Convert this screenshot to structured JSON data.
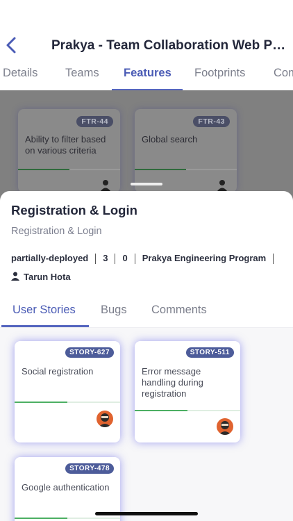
{
  "header": {
    "title": "Prakya - Team Collaboration Web Platf…",
    "tabs": [
      {
        "label": "Details"
      },
      {
        "label": "Teams"
      },
      {
        "label": "Features"
      },
      {
        "label": "Footprints"
      },
      {
        "label": "Com"
      }
    ],
    "active_tab": "Features"
  },
  "background_features": [
    {
      "id": "FTR-44",
      "title": "Ability to filter based on various criteria"
    },
    {
      "id": "FTR-43",
      "title": "Global search"
    }
  ],
  "sheet": {
    "title": "Registration & Login",
    "subtitle": "Registration & Login",
    "status": "partially-deployed",
    "count_a": "3",
    "count_b": "0",
    "program": "Prakya Engineering Program",
    "owner": "Tarun Hota",
    "tabs": [
      {
        "label": "User Stories"
      },
      {
        "label": "Bugs"
      },
      {
        "label": "Comments"
      }
    ],
    "active_tab": "User Stories",
    "stories": [
      {
        "id": "STORY-627",
        "title": "Social registration",
        "progress": 0.5
      },
      {
        "id": "STORY-511",
        "title": "Error message handling during registration",
        "progress": 0.5
      },
      {
        "id": "STORY-478",
        "title": "Google authentication",
        "progress": 0.5
      }
    ]
  },
  "colors": {
    "accent": "#5566bf",
    "badge": "#4d5c9a",
    "progress": "#4caf63",
    "avatar": "#e0632f"
  },
  "icons": [
    "back-chevron-icon",
    "user-icon",
    "avatar-icon"
  ]
}
